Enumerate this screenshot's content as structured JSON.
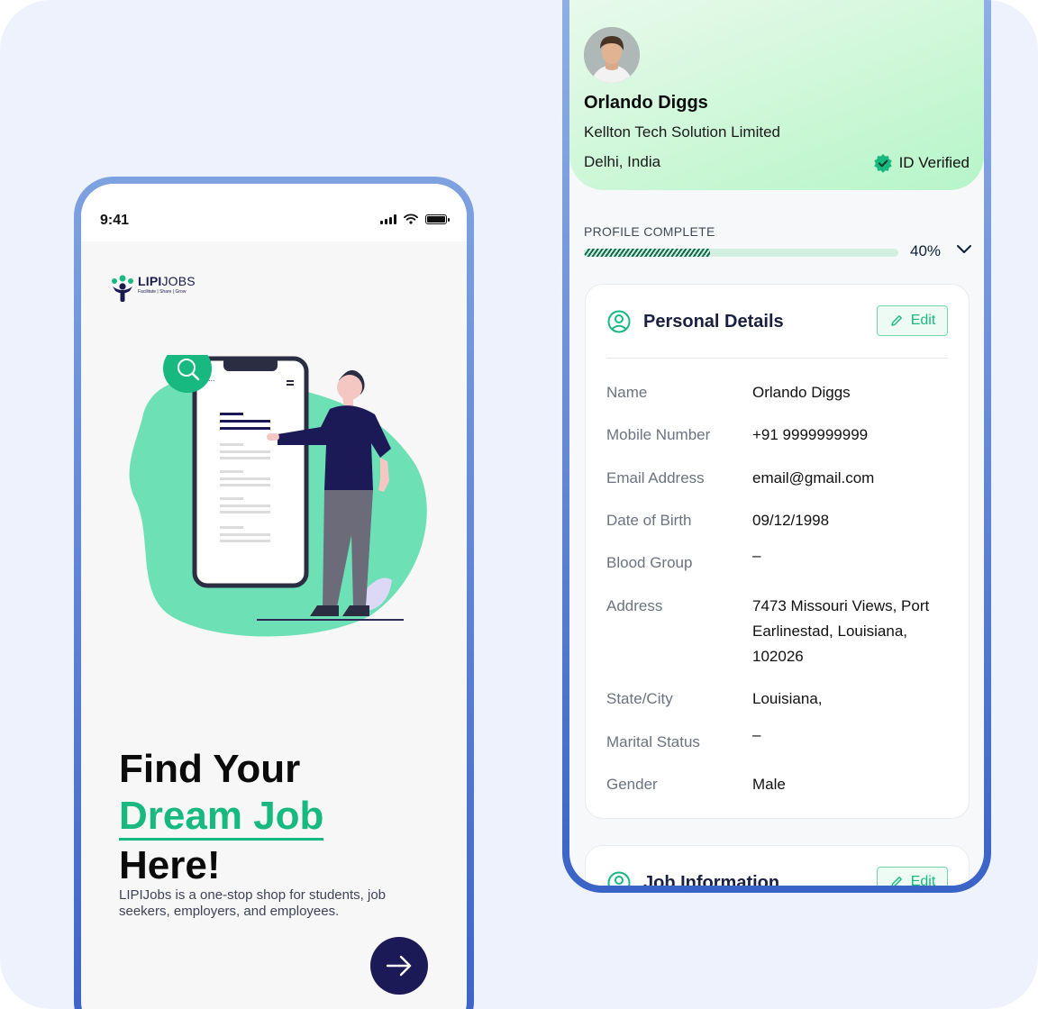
{
  "left_phone": {
    "status_time": "9:41",
    "logo": {
      "brand_bold": "LIPI",
      "brand_light": "JOBS",
      "tagline": "Facilitate | Share | Grow"
    },
    "headline_line1": "Find Your",
    "headline_line2": "Dream Job",
    "headline_line3": "Here!",
    "subcopy": "LIPIJobs is a one-stop shop for students, job seekers, employers, and employees.",
    "next_button_icon": "arrow-right-icon"
  },
  "right_phone": {
    "profile": {
      "name": "Orlando Diggs",
      "company": "Kellton Tech Solution Limited",
      "location": "Delhi, India",
      "verified_label": "ID Verified"
    },
    "profile_complete": {
      "label": "PROFILE COMPLETE",
      "value_text": "40%",
      "fraction": 0.4
    },
    "personal_details": {
      "title": "Personal Details",
      "edit_label": "Edit",
      "fields": [
        {
          "label": "Name",
          "value": "Orlando Diggs"
        },
        {
          "label": "Mobile Number",
          "value": "+91 9999999999"
        },
        {
          "label": "Email Address",
          "value": "email@gmail.com"
        },
        {
          "label": "Date of Birth",
          "value": "09/12/1998"
        },
        {
          "label": "Blood Group",
          "value": "–"
        },
        {
          "label": "Address",
          "value": "7473 Missouri Views, Port Earlinestad, Louisiana, 102026"
        },
        {
          "label": "State/City",
          "value": "Louisiana,"
        },
        {
          "label": "Marital Status",
          "value": "–"
        },
        {
          "label": "Gender",
          "value": "Male"
        }
      ]
    },
    "job_information": {
      "title": "Job Information",
      "edit_label": "Edit"
    }
  },
  "colors": {
    "accent_green": "#17b981",
    "navy": "#1b1a57",
    "blob_green": "#6ee0b6",
    "phone_frame": "#3a63c7"
  }
}
